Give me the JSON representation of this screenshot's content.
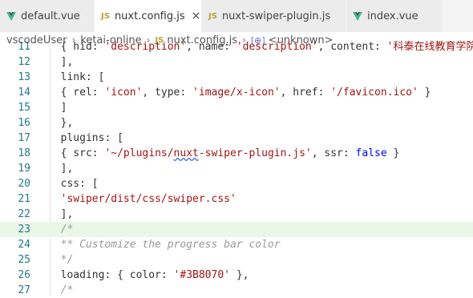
{
  "tabs": [
    {
      "label": "default.vue",
      "icon": "vue-icon"
    },
    {
      "label": "nuxt.config.js",
      "icon": "js-icon",
      "active": true
    },
    {
      "label": "nuxt-swiper-plugin.js",
      "icon": "js-icon"
    },
    {
      "label": "index.vue",
      "icon": "vue-icon"
    }
  ],
  "breadcrumbs": {
    "root": "vscodeUser",
    "folder": "ketai-online",
    "file": "nuxt.config.js",
    "symbol": "<unknown>",
    "js_label": "JS"
  },
  "tab_js_label": "JS",
  "close_glyph": "×",
  "lines": [
    {
      "n": "11",
      "text": "  { hid: 'description', name: 'description', content: '科泰在线教育学院'"
    },
    {
      "n": "12",
      "text": "  ],"
    },
    {
      "n": "13",
      "text": "  link: ["
    },
    {
      "n": "14",
      "text": "  { rel: 'icon', type: 'image/x-icon', href: '/favicon.ico' }"
    },
    {
      "n": "15",
      "text": "  ]"
    },
    {
      "n": "16",
      "text": "  },"
    },
    {
      "n": "17",
      "text": "  plugins: ["
    },
    {
      "n": "18",
      "text": "  { src: '~/plugins/nuxt-swiper-plugin.js', ssr: false }"
    },
    {
      "n": "19",
      "text": "  ],"
    },
    {
      "n": "20",
      "text": "  css: ["
    },
    {
      "n": "21",
      "text": "  'swiper/dist/css/swiper.css'"
    },
    {
      "n": "22",
      "text": "  ],"
    },
    {
      "n": "23",
      "text": "  /*"
    },
    {
      "n": "24",
      "text": "  ** Customize the progress bar color"
    },
    {
      "n": "25",
      "text": "  */"
    },
    {
      "n": "26",
      "text": "  loading: { color: '#3B8070' },"
    },
    {
      "n": "27",
      "text": "  /*"
    }
  ],
  "colors": {
    "vue_green": "#41b883",
    "js_yellow": "#b8a33a",
    "line_number": "#237893",
    "string": "#a31515",
    "keyword": "#0000ff",
    "comment": "#9a9a9a",
    "current_line": "#eaf7e6"
  }
}
